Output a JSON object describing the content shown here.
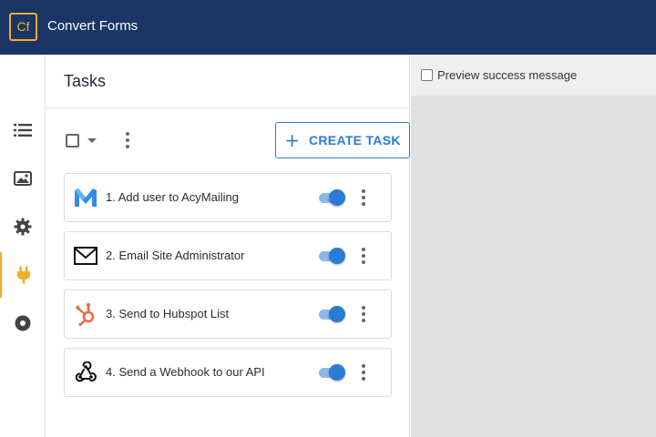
{
  "app": {
    "logo_text": "Cf",
    "title": "Convert Forms"
  },
  "rail": {
    "items": [
      {
        "icon": "list-icon"
      },
      {
        "icon": "image-icon"
      },
      {
        "icon": "gear-icon"
      },
      {
        "icon": "plug-icon",
        "active": true
      },
      {
        "icon": "record-icon"
      }
    ]
  },
  "panel": {
    "title": "Tasks",
    "create_button_label": "CREATE TASK"
  },
  "tasks": [
    {
      "label": "1. Add user to AcyMailing",
      "icon": "acymailing-icon",
      "enabled": true
    },
    {
      "label": "2. Email Site Administrator",
      "icon": "email-icon",
      "enabled": true
    },
    {
      "label": "3. Send to Hubspot List",
      "icon": "hubspot-icon",
      "enabled": true
    },
    {
      "label": "4. Send a Webhook to our API",
      "icon": "webhook-icon",
      "enabled": true
    }
  ],
  "preview": {
    "checkbox_label": "Preview success message",
    "checked": false
  },
  "colors": {
    "topbar": "#1b3566",
    "accent": "#f0ad28",
    "primary": "#2a7bd3"
  }
}
